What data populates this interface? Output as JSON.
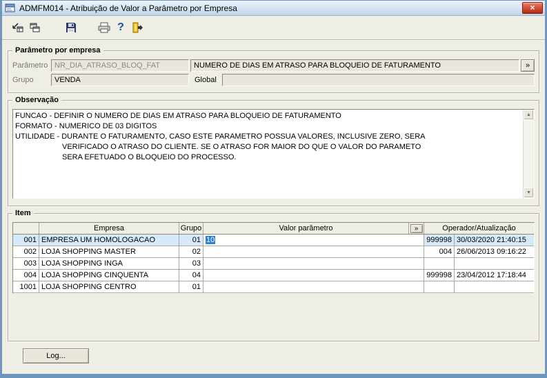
{
  "window": {
    "title": "ADMFM014 - Atribuição de Valor a Parâmetro por Empresa",
    "close_glyph": "×"
  },
  "toolbar": {
    "icons": [
      "export-record-icon",
      "copy-records-icon",
      "save-icon",
      "print-icon",
      "help-icon",
      "exit-icon"
    ],
    "help_glyph": "?"
  },
  "param_section": {
    "legend": "Parâmetro por empresa",
    "param_label": "Parâmetro",
    "param_value": "NR_DIA_ATRASO_BLOQ_FAT",
    "param_desc": "NUMERO DE DIAS EM ATRASO PARA BLOQUEIO DE FATURAMENTO",
    "expand_button": "»",
    "group_label": "Grupo",
    "group_value": "VENDA",
    "global_label": "Global",
    "global_value": ""
  },
  "observation": {
    "legend": "Observação",
    "scroll_up_glyph": "▲",
    "scroll_down_glyph": "▼",
    "lines": [
      "FUNCAO - DEFINIR O NUMERO DE DIAS EM ATRASO PARA BLOQUEIO DE FATURAMENTO",
      "FORMATO - NUMERICO DE 03 DIGITOS",
      "UTILIDADE - DURANTE O FATURAMENTO, CASO ESTE PARAMETRO POSSUA VALORES, INCLUSIVE ZERO, SERA",
      "VERIFICADO O ATRASO DO CLIENTE. SE O ATRASO FOR MAIOR DO QUE O VALOR DO PARAMETO",
      "SERA EFETUADO O BLOQUEIO DO PROCESSO."
    ]
  },
  "item_section": {
    "legend": "Item",
    "headers": {
      "empresa": "Empresa",
      "grupo": "Grupo",
      "valor": "Valor parâmetro",
      "expand": "»",
      "operador": "Operador/Atualização"
    },
    "rows": [
      {
        "num": "001",
        "empresa": "EMPRESA UM  HOMOLOGACAO",
        "grupo": "01",
        "valor": "10",
        "operador": "999998",
        "atualizacao": "30/03/2020 21:40:15",
        "selected": true
      },
      {
        "num": "002",
        "empresa": "LOJA SHOPPING MASTER",
        "grupo": "02",
        "valor": "",
        "operador": "004",
        "atualizacao": "26/06/2013 09:16:22",
        "selected": false
      },
      {
        "num": "003",
        "empresa": "LOJA SHOPPING INGA",
        "grupo": "03",
        "valor": "",
        "operador": "",
        "atualizacao": "",
        "selected": false
      },
      {
        "num": "004",
        "empresa": "LOJA SHOPPING CINQUENTA",
        "grupo": "04",
        "valor": "",
        "operador": "999998",
        "atualizacao": "23/04/2012 17:18:44",
        "selected": false
      },
      {
        "num": "1001",
        "empresa": "LOJA SHOPPING  CENTRO",
        "grupo": "01",
        "valor": "",
        "operador": "",
        "atualizacao": "",
        "selected": false
      }
    ]
  },
  "footer": {
    "log_label": "Log..."
  },
  "colors": {
    "window_border": "#7096bf",
    "selected_row": "#d6e9f8",
    "selection": "#2e7fd0",
    "close_button": "#b42f1a"
  }
}
